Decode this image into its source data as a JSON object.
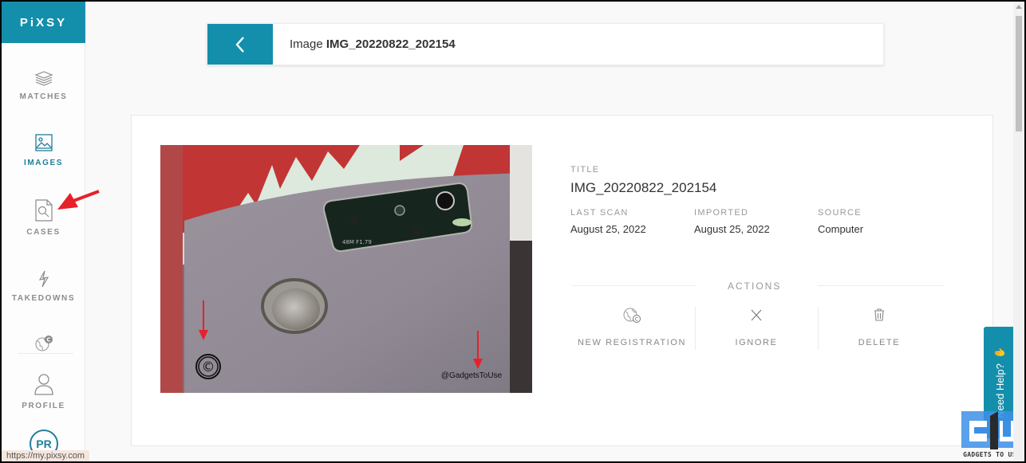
{
  "app": {
    "logo": "PiXSY",
    "brand_color": "#148fab",
    "status_url": "https://my.pixsy.com"
  },
  "sidebar": {
    "items": [
      {
        "id": "matches",
        "label": "MATCHES",
        "icon": "layers-icon",
        "active": false
      },
      {
        "id": "images",
        "label": "IMAGES",
        "icon": "image-icon",
        "active": true
      },
      {
        "id": "cases",
        "label": "CASES",
        "icon": "case-search-icon",
        "active": false
      },
      {
        "id": "takedowns",
        "label": "TAKEDOWNS",
        "icon": "lightning-icon",
        "active": false
      },
      {
        "id": "registration",
        "label": "",
        "icon": "globe-copyright-icon",
        "active": false
      },
      {
        "id": "profile",
        "label": "PROFILE",
        "icon": "user-icon",
        "active": false
      }
    ],
    "avatar_initials": "PR"
  },
  "header": {
    "prefix": "Image",
    "image_name": "IMG_20220822_202154"
  },
  "details": {
    "title_label": "TITLE",
    "title_value": "IMG_20220822_202154",
    "last_scan_label": "LAST SCAN",
    "last_scan_value": "August 25, 2022",
    "imported_label": "IMPORTED",
    "imported_value": "August 25, 2022",
    "source_label": "SOURCE",
    "source_value": "Computer"
  },
  "actions": {
    "heading": "ACTIONS",
    "items": [
      {
        "label": "NEW REGISTRATION",
        "icon": "globe-copyright-icon"
      },
      {
        "label": "IGNORE",
        "icon": "close-icon"
      },
      {
        "label": "DELETE",
        "icon": "trash-icon"
      }
    ]
  },
  "image_preview": {
    "camera_text": "48M  F1.79",
    "watermark_handle": "@GadgetsToUse",
    "copyright_symbol": "©"
  },
  "help": {
    "label": "Need Help?"
  },
  "site_watermark": {
    "text": "GADGETS TO USE"
  }
}
